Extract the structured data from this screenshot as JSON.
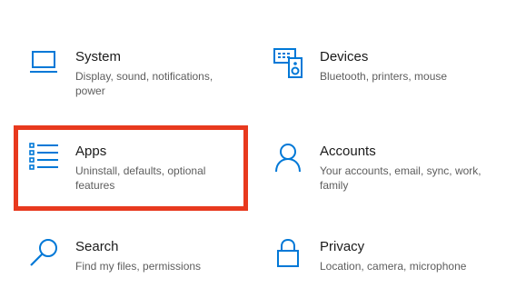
{
  "settings": {
    "tiles": [
      {
        "title": "System",
        "desc": "Display, sound, notifications, power",
        "icon": "laptop-icon"
      },
      {
        "title": "Devices",
        "desc": "Bluetooth, printers, mouse",
        "icon": "keyboard-speaker-icon"
      },
      {
        "title": "Apps",
        "desc": "Uninstall, defaults, optional features",
        "icon": "apps-list-icon"
      },
      {
        "title": "Accounts",
        "desc": "Your accounts, email, sync, work, family",
        "icon": "person-icon"
      },
      {
        "title": "Search",
        "desc": "Find my files, permissions",
        "icon": "search-icon"
      },
      {
        "title": "Privacy",
        "desc": "Location, camera, microphone",
        "icon": "lock-icon"
      }
    ]
  },
  "colors": {
    "accent": "#0078d7",
    "highlight": "#e8391e",
    "title_text": "#1a1a1a",
    "desc_text": "#5d5d5d"
  }
}
